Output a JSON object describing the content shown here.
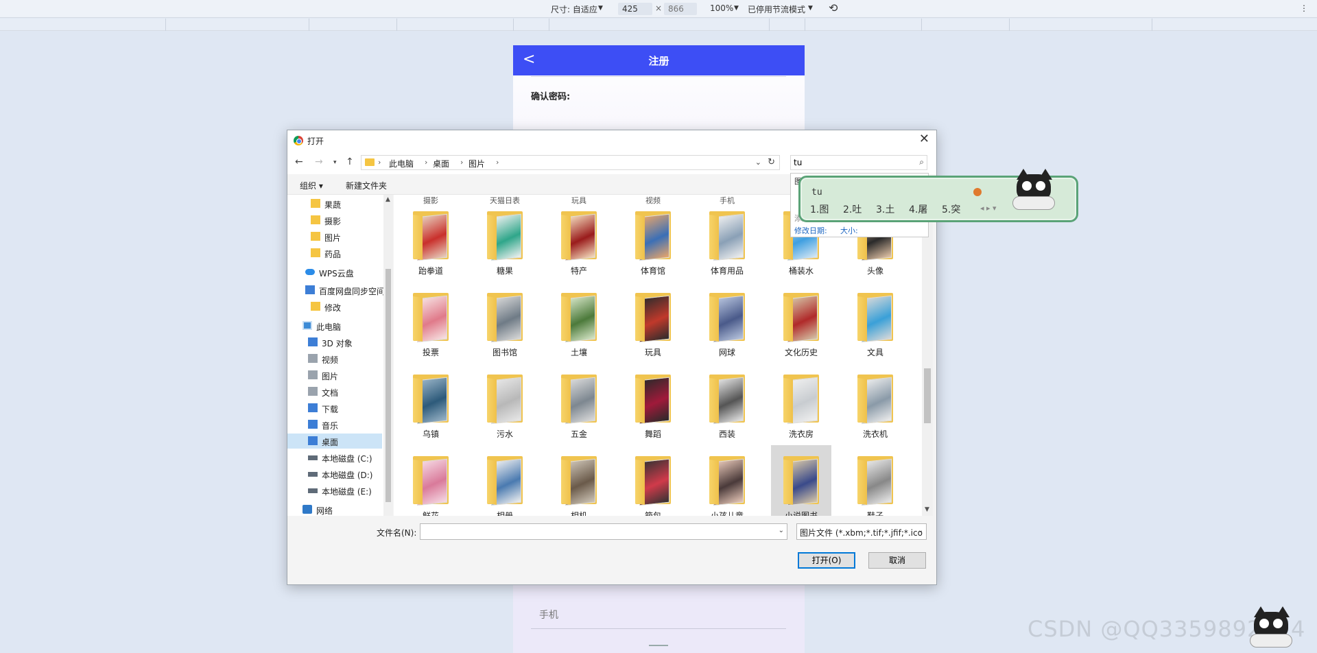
{
  "devtools": {
    "size_label": "尺寸: 自适应",
    "width": "425",
    "times": "×",
    "height": "866",
    "zoom": "100%",
    "throttle": "已停用节流模式"
  },
  "phone": {
    "back": "<",
    "title": "注册",
    "confirm_password_label": "确认密码:",
    "mobile_placeholder": "手机"
  },
  "watermark": "CSDN @QQ3359892174",
  "dialog": {
    "title": "打开",
    "close": "✕",
    "breadcrumb": [
      "此电脑",
      "桌面",
      "图片"
    ],
    "search_value": "tu",
    "organize": "组织 ▾",
    "new_folder": "新建文件夹",
    "nav_items": [
      {
        "label": "果蔬",
        "icon": "folder-icon"
      },
      {
        "label": "摄影",
        "icon": "folder-icon"
      },
      {
        "label": "图片",
        "icon": "folder-icon"
      },
      {
        "label": "药品",
        "icon": "folder-icon"
      },
      {
        "label": "WPS云盘",
        "icon": "cloud-icon"
      },
      {
        "label": "百度网盘同步空间",
        "icon": "sync-icon"
      },
      {
        "label": "修改",
        "icon": "folder-icon"
      },
      {
        "label": "此电脑",
        "icon": "pc-icon"
      },
      {
        "label": "3D 对象",
        "icon": "cube-icon"
      },
      {
        "label": "视频",
        "icon": "video-icon"
      },
      {
        "label": "图片",
        "icon": "pictures-icon"
      },
      {
        "label": "文档",
        "icon": "document-icon"
      },
      {
        "label": "下载",
        "icon": "download-icon"
      },
      {
        "label": "音乐",
        "icon": "music-icon"
      },
      {
        "label": "桌面",
        "icon": "desktop-icon"
      },
      {
        "label": "本地磁盘 (C:)",
        "icon": "disk-icon"
      },
      {
        "label": "本地磁盘 (D:)",
        "icon": "disk-icon"
      },
      {
        "label": "本地磁盘 (E:)",
        "icon": "disk-icon"
      },
      {
        "label": "网络",
        "icon": "network-icon"
      }
    ],
    "partial_row": [
      "摄影",
      "天猫日表",
      "玩具",
      "视频",
      "手机"
    ],
    "folders": [
      [
        "跆拳道",
        "糖果",
        "特产",
        "体育馆",
        "体育用品",
        "桶装水",
        "头像"
      ],
      [
        "投票",
        "图书馆",
        "土壤",
        "玩具",
        "网球",
        "文化历史",
        "文具"
      ],
      [
        "乌镇",
        "污水",
        "五金",
        "舞蹈",
        "西装",
        "洗衣房",
        "洗衣机"
      ],
      [
        "鲜花",
        "相册",
        "相机",
        "箱包",
        "小孩儿童",
        "小说图书",
        "鞋子"
      ]
    ],
    "search_dropdown": {
      "heading": "图片",
      "add_filter": "添加搜索筛选器",
      "modified": "修改日期:",
      "size": "大小:"
    },
    "filename_label": "文件名(N):",
    "filename_value": "",
    "filetype": "图片文件 (*.xbm;*.tif;*.jfif;*.ico",
    "open_button": "打开(O)",
    "cancel_button": "取消"
  },
  "ime": {
    "composition": "tu",
    "candidates": [
      "1.图",
      "2.吐",
      "3.土",
      "4.屠",
      "5.突"
    ]
  },
  "colors": {
    "header_blue": "#3d4ef5",
    "folder_yellow": "#f0c44f",
    "selection_blue": "#cce4f7",
    "ime_green": "#5aa377"
  }
}
